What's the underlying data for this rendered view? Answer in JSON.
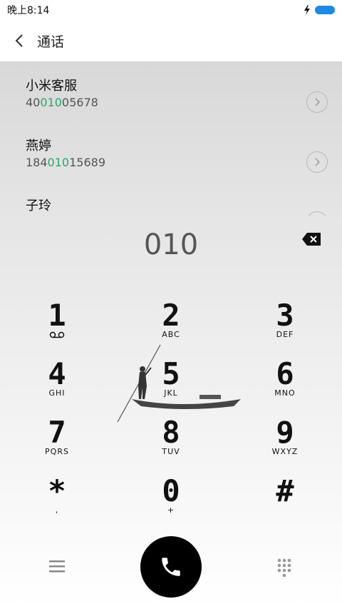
{
  "status_bar": {
    "time": "晚上8:14"
  },
  "header": {
    "title": "通话"
  },
  "contacts": [
    {
      "name": "小米客服",
      "number_prefix": "40",
      "number_match": "010",
      "number_suffix": "05678"
    },
    {
      "name": "燕婷",
      "number_prefix": "184",
      "number_match": "010",
      "number_suffix": "15689"
    },
    {
      "name": "子玲",
      "number_prefix": "",
      "number_match": "",
      "number_suffix": ""
    }
  ],
  "dialed_number": "010",
  "keypad": [
    {
      "digit": "1",
      "letters": ""
    },
    {
      "digit": "2",
      "letters": "ABC"
    },
    {
      "digit": "3",
      "letters": "DEF"
    },
    {
      "digit": "4",
      "letters": "GHI"
    },
    {
      "digit": "5",
      "letters": "JKL"
    },
    {
      "digit": "6",
      "letters": "MNO"
    },
    {
      "digit": "7",
      "letters": "PQRS"
    },
    {
      "digit": "8",
      "letters": "TUV"
    },
    {
      "digit": "9",
      "letters": "WXYZ"
    },
    {
      "digit": "*",
      "letters": ","
    },
    {
      "digit": "0",
      "letters": "+"
    },
    {
      "digit": "#",
      "letters": ""
    }
  ],
  "icons": {
    "back": "chevron-left-icon",
    "backspace": "backspace-icon",
    "voicemail": "voicemail-icon",
    "menu": "menu-icon",
    "call": "phone-icon",
    "dialpad": "dialpad-icon",
    "charging": "charging-icon",
    "battery": "battery-icon"
  },
  "colors": {
    "match_highlight": "#27a86b",
    "battery": "#1e88e5",
    "call_button": "#000000"
  }
}
